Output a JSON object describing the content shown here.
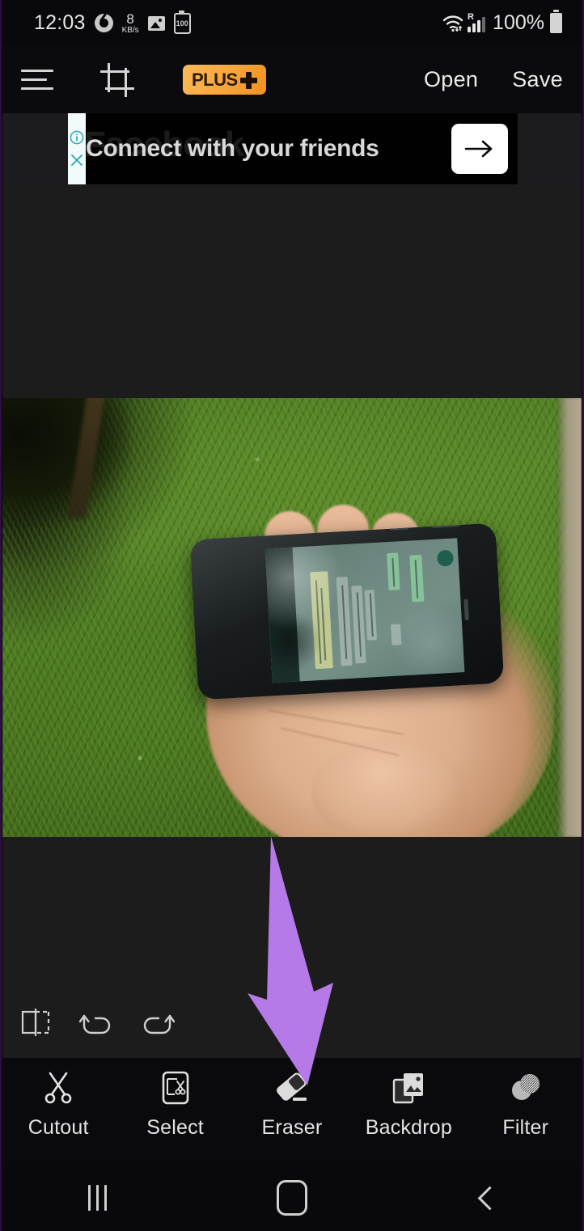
{
  "status_bar": {
    "clock": "12:03",
    "chrome_icon": "chrome-icon",
    "network_speed_value": "8",
    "network_speed_unit": "KB/s",
    "gallery_icon": "image-icon",
    "battery_saver_value": "100",
    "wifi_icon": "wifi-icon",
    "roaming_label": "R",
    "signal_icon": "signal-bars-icon",
    "battery_percent": "100%",
    "battery_icon": "battery-full-icon"
  },
  "app_bar": {
    "menu_icon": "hamburger-menu-icon",
    "crop_icon": "crop-icon",
    "plus_badge_text": "PLUS",
    "plus_badge_symbol": "+",
    "open_label": "Open",
    "save_label": "Save"
  },
  "ad": {
    "watermark": "Facebook",
    "headline": "Connect with your friends",
    "info_icon": "ad-info-icon",
    "close_icon": "ad-close-icon",
    "cta_icon": "arrow-right-icon"
  },
  "canvas": {
    "background_color": "#1c1c1c",
    "photo_alt": "Hand holding a smartphone over green grass"
  },
  "annotation": {
    "arrow_color": "#b57ae8",
    "points_to": "Eraser"
  },
  "tool_row": {
    "items": [
      {
        "name": "transform-icon",
        "label": "Transform"
      },
      {
        "name": "undo-icon",
        "label": "Undo"
      },
      {
        "name": "redo-icon",
        "label": "Redo"
      }
    ]
  },
  "bottom_bar": {
    "items": [
      {
        "label": "Cutout",
        "icon": "scissors-icon"
      },
      {
        "label": "Select",
        "icon": "select-region-icon"
      },
      {
        "label": "Eraser",
        "icon": "eraser-icon"
      },
      {
        "label": "Backdrop",
        "icon": "backdrop-image-icon"
      },
      {
        "label": "Filter",
        "icon": "filter-circle-icon"
      }
    ]
  },
  "nav_bar": {
    "recents_icon": "recents-icon",
    "home_icon": "home-icon",
    "back_icon": "back-icon"
  },
  "colors": {
    "accent_orange": "#f9a93f",
    "annotation_purple": "#b57ae8",
    "canvas_dark": "#1c1c1c",
    "chrome_bar": "#0a0a0c"
  }
}
